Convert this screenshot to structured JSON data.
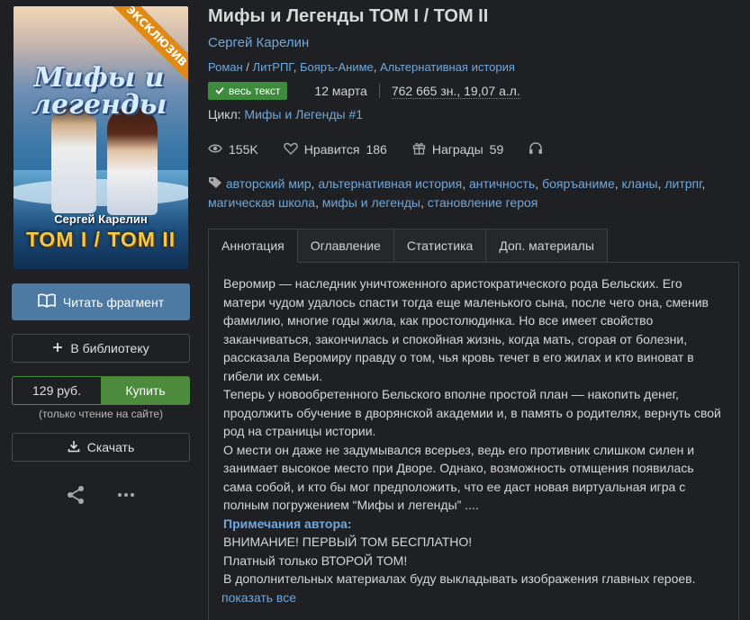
{
  "cover": {
    "badge": "ЭКСКЛЮЗИВ",
    "title_art": "Мифы и легенды",
    "author_art": "Сергей Карелин",
    "tom_art": "ТОМ I / ТОМ II"
  },
  "actions": {
    "read_fragment": "Читать фрагмент",
    "add_library": "В библиотеку",
    "price": "129 руб.",
    "buy": "Купить",
    "buy_note": "(только чтение на сайте)",
    "download": "Скачать"
  },
  "book": {
    "title": "Мифы и Легенды ТОМ I / ТОМ II",
    "author": "Сергей Карелин",
    "genres": [
      "Роман",
      "ЛитРПГ",
      "Бояръ-Аниме",
      "Альтернативная история"
    ],
    "status_badge": "весь текст",
    "date": "12 марта",
    "size": "762 665 зн., 19,07 а.л.",
    "cycle_label": "Цикл:",
    "cycle": "Мифы и Легенды #1",
    "views": "155K",
    "likes_label": "Нравится",
    "likes": "186",
    "awards_label": "Награды",
    "awards": "59",
    "tags": [
      "авторский мир",
      "альтернативная история",
      "античность",
      "бояръаниме",
      "кланы",
      "литрпг",
      "магическая школа",
      "мифы и легенды",
      "становление героя"
    ]
  },
  "tabs": [
    "Аннотация",
    "Оглавление",
    "Статистика",
    "Доп. материалы"
  ],
  "annotation": {
    "p1": "Веромир — наследник уничтоженного аристократического рода Бельских. Его матери чудом удалось спасти тогда еще маленького сына, после чего она, сменив фамилию, многие годы жила, как простолюдинка. Но все имеет свойство заканчиваться, закончилась и спокойная жизнь, когда мать, сгорая от болезни, рассказала Веромиру правду о том, чья кровь течет в его жилах и кто виноват в гибели их семьи.",
    "p2": "Теперь у новообретенного Бельского вполне простой план — накопить денег, продолжить обучение в дворянской академии и, в память о родителях, вернуть свой род на страницы истории.",
    "p3": "О мести он даже не задумывался всерьез, ведь его противник слишком силен и занимает высокое место при Дворе. Однако, возможность отмщения появилась сама собой, и кто бы мог предположить, что ее даст новая виртуальная игра с полным погружением “Мифы и легенды” ....",
    "notes_title": "Примечания автора:",
    "note1": "ВНИМАНИЕ! ПЕРВЫЙ ТОМ БЕСПЛАТНО!",
    "note2": "Платный только ВТОРОЙ ТОМ!",
    "note3": "В дополнительных материалах буду выкладывать изображения главных героев.",
    "show_all": "показать все"
  },
  "colors": {
    "background": "#1f2023",
    "link": "#6fa8dc",
    "read_button": "#4d7aa3",
    "buy_button": "#4c8b3c",
    "badge_green": "#3d8b3d"
  }
}
